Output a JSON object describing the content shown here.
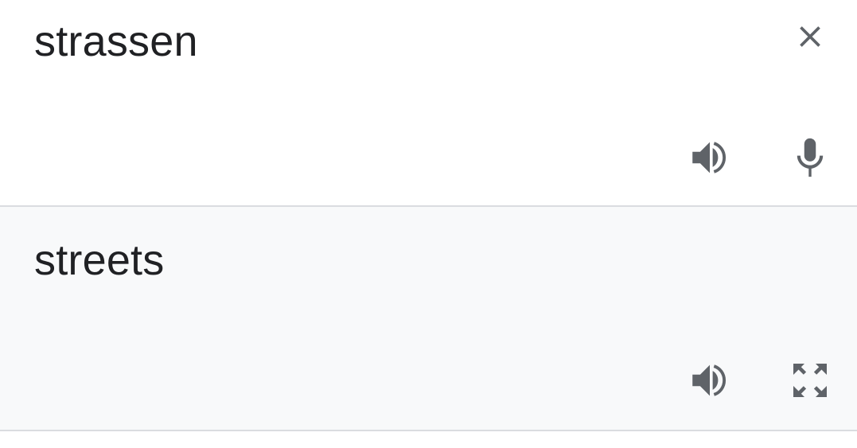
{
  "source": {
    "text": "strassen",
    "icons": {
      "clear": "close-icon",
      "speak": "speaker-icon",
      "mic": "microphone-icon"
    }
  },
  "result": {
    "text": "streets",
    "icons": {
      "speak": "speaker-icon",
      "expand": "fullscreen-icon"
    }
  },
  "colors": {
    "text": "#202124",
    "icon": "#5f6368",
    "result_background": "#f8f9fa",
    "divider": "#dadce0"
  }
}
